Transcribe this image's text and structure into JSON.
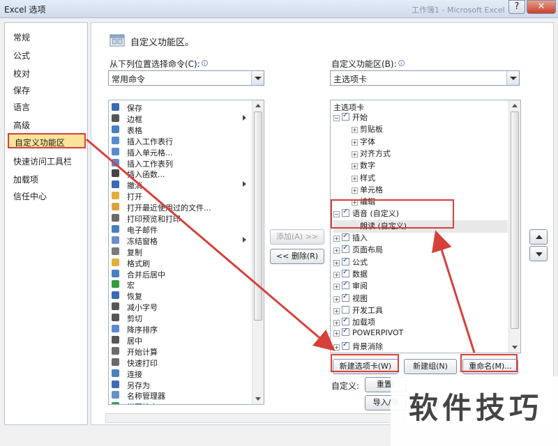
{
  "window": {
    "title": "Excel 选项",
    "background_title": "工作簿1 - Microsoft Excel",
    "help_label": "?",
    "close_label": "✕"
  },
  "nav": {
    "items": [
      "常规",
      "公式",
      "校对",
      "保存",
      "语言",
      "高级",
      "自定义功能区",
      "快速访问工具栏",
      "加载项",
      "信任中心"
    ],
    "active": "自定义功能区"
  },
  "section": {
    "title": "自定义功能区。"
  },
  "left": {
    "choose_label": "从下列位置选择命令(C):",
    "choose_value": "常用命令",
    "commands": [
      {
        "label": "保存",
        "icon": "save-icon",
        "sub": false
      },
      {
        "label": "边框",
        "icon": "border-icon",
        "sub": true
      },
      {
        "label": "表格",
        "icon": "table-icon",
        "sub": false
      },
      {
        "label": "插入工作表行",
        "icon": "insert-row-icon",
        "sub": false
      },
      {
        "label": "插入单元格...",
        "icon": "insert-cell-icon",
        "sub": false
      },
      {
        "label": "插入工作表列",
        "icon": "insert-column-icon",
        "sub": false
      },
      {
        "label": "插入函数...",
        "icon": "function-icon",
        "sub": false
      },
      {
        "label": "撤消",
        "icon": "undo-icon",
        "sub": true
      },
      {
        "label": "打开",
        "icon": "open-folder-icon",
        "sub": false
      },
      {
        "label": "打开最近使用过的文件...",
        "icon": "recent-file-icon",
        "sub": false
      },
      {
        "label": "打印预览和打印",
        "icon": "print-preview-icon",
        "sub": false
      },
      {
        "label": "电子邮件",
        "icon": "email-icon",
        "sub": false
      },
      {
        "label": "冻结窗格",
        "icon": "freeze-panes-icon",
        "sub": true
      },
      {
        "label": "复制",
        "icon": "copy-icon",
        "sub": false
      },
      {
        "label": "格式刷",
        "icon": "format-painter-icon",
        "sub": false
      },
      {
        "label": "合并后居中",
        "icon": "merge-center-icon",
        "sub": false
      },
      {
        "label": "宏",
        "icon": "macro-icon",
        "sub": false
      },
      {
        "label": "恢复",
        "icon": "redo-icon",
        "sub": false
      },
      {
        "label": "减小字号",
        "icon": "decrease-font-icon",
        "sub": false
      },
      {
        "label": "剪切",
        "icon": "cut-icon",
        "sub": false
      },
      {
        "label": "降序排序",
        "icon": "sort-desc-icon",
        "sub": false
      },
      {
        "label": "居中",
        "icon": "align-center-icon",
        "sub": false
      },
      {
        "label": "开始计算",
        "icon": "calculate-icon",
        "sub": false
      },
      {
        "label": "快速打印",
        "icon": "quick-print-icon",
        "sub": false
      },
      {
        "label": "连接",
        "icon": "connections-icon",
        "sub": false
      },
      {
        "label": "另存为",
        "icon": "save-as-icon",
        "sub": false
      },
      {
        "label": "名称管理器",
        "icon": "name-manager-icon",
        "sub": false
      },
      {
        "label": "拼写检查",
        "icon": "spell-check-icon",
        "sub": false
      }
    ]
  },
  "middle": {
    "add_label": "添加(A) >>",
    "remove_label": "<< 删除(R)"
  },
  "right": {
    "customize_label": "自定义功能区(B):",
    "customize_value": "主选项卡",
    "tree_header": "主选项卡",
    "tree": [
      {
        "label": "开始",
        "level": 0,
        "exp": "⊟",
        "check": true
      },
      {
        "label": "剪贴板",
        "level": 1,
        "exp": "⊞",
        "check": null
      },
      {
        "label": "字体",
        "level": 1,
        "exp": "⊞",
        "check": null
      },
      {
        "label": "对齐方式",
        "level": 1,
        "exp": "⊞",
        "check": null
      },
      {
        "label": "数字",
        "level": 1,
        "exp": "⊞",
        "check": null
      },
      {
        "label": "样式",
        "level": 1,
        "exp": "⊞",
        "check": null
      },
      {
        "label": "单元格",
        "level": 1,
        "exp": "⊞",
        "check": null
      },
      {
        "label": "编辑",
        "level": 1,
        "exp": "⊞",
        "check": null
      },
      {
        "label": "语音 (自定义)",
        "level": 0,
        "exp": "⊟",
        "check": true
      },
      {
        "label": "朗读 (自定义)",
        "level": 2,
        "exp": "",
        "check": null,
        "selected": true
      },
      {
        "label": "插入",
        "level": 0,
        "exp": "⊞",
        "check": true
      },
      {
        "label": "页面布局",
        "level": 0,
        "exp": "⊞",
        "check": true
      },
      {
        "label": "公式",
        "level": 0,
        "exp": "⊞",
        "check": true
      },
      {
        "label": "数据",
        "level": 0,
        "exp": "⊞",
        "check": true
      },
      {
        "label": "审阅",
        "level": 0,
        "exp": "⊞",
        "check": true
      },
      {
        "label": "视图",
        "level": 0,
        "exp": "⊞",
        "check": true
      },
      {
        "label": "开发工具",
        "level": 0,
        "exp": "⊞",
        "check": false
      },
      {
        "label": "加载项",
        "level": 0,
        "exp": "⊞",
        "check": true
      },
      {
        "label": "POWERPIVOT",
        "level": 0,
        "exp": "⊞",
        "check": true
      },
      {
        "label": "背景消除",
        "level": 0,
        "exp": "⊞",
        "check": true
      }
    ],
    "new_tab_label": "新建选项卡(W)",
    "new_group_label": "新建组(N)",
    "rename_label": "重命名(M)...",
    "customizations_label": "自定义:",
    "reset_label": "重置(",
    "import_export_label": "导入/导"
  },
  "watermark": "软件技巧",
  "colors": {
    "highlight": "#d6403a",
    "active_nav": "#fbe39b"
  }
}
